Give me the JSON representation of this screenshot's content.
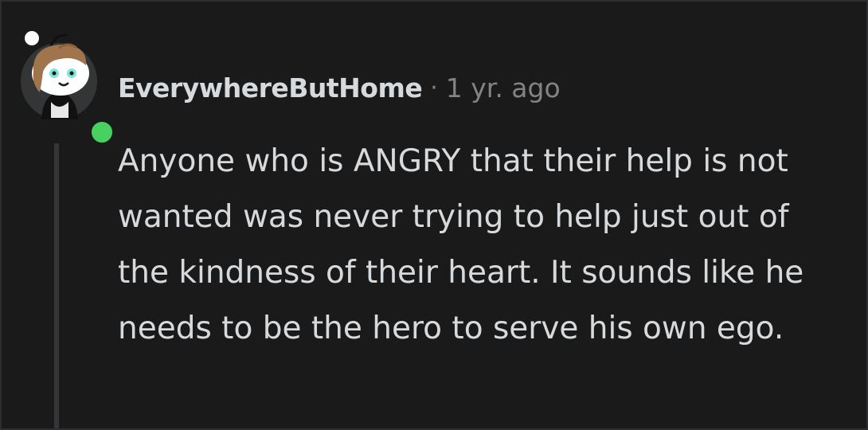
{
  "comment": {
    "author": "EverywhereButHome",
    "separator": "·",
    "timestamp": "1 yr. ago",
    "body": "Anyone who is ANGRY that their help is not wanted was never trying to help just out of the kindness of their heart. It sounds like he needs to be the hero to serve his own ego.",
    "online_status_color": "#46d160"
  },
  "icons": {
    "avatar": "user-avatar-icon",
    "online_status": "online-status-icon"
  },
  "colors": {
    "background": "#1a1a1b",
    "text": "#d7dadc",
    "meta": "#818384",
    "thread_line": "#343536"
  }
}
